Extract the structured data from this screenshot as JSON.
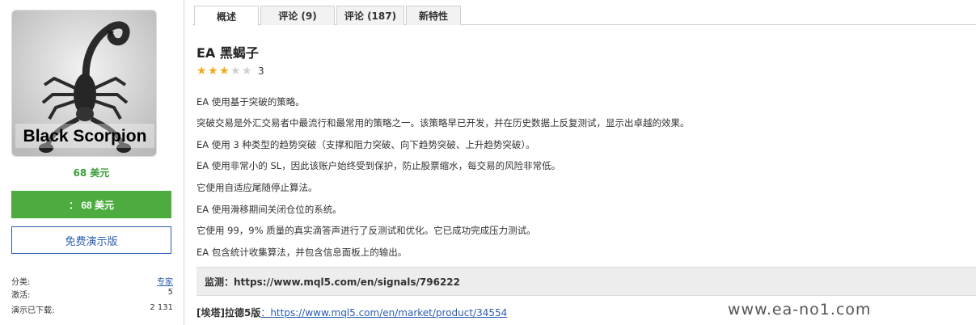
{
  "product": {
    "image_caption": "Black Scorpion",
    "price_text": "68 美元",
    "buy_label": "： 68 美元",
    "demo_label": "免费演示版"
  },
  "meta": {
    "category_label": "分类:",
    "category_value": "专家",
    "activations_label": "激活:",
    "activations_value": "5",
    "downloads_label": "演示已下载:",
    "downloads_value": "2 131"
  },
  "tabs": [
    {
      "label": "概述",
      "active": true
    },
    {
      "label": "评论 (9)",
      "active": false
    },
    {
      "label": "评论 (187)",
      "active": false
    },
    {
      "label": "新特性",
      "active": false
    }
  ],
  "main": {
    "title": "EA 黑蝎子",
    "rating": {
      "stars": 3,
      "max": 5,
      "value": "3"
    },
    "description": [
      "EA 使用基于突破的策略。",
      "突破交易是外汇交易者中最流行和最常用的策略之一。该策略早已开发，并在历史数据上反复测试，显示出卓越的效果。",
      "EA 使用 3 种类型的趋势突破（支撑和阻力突破、向下趋势突破、上升趋势突破）。",
      "EA 使用非常小的 SL，因此该账户始终受到保护，防止股票缩水，每交易的风险非常低。",
      "它使用自适应尾随停止算法。",
      "EA 使用滑移期间关闭仓位的系统。",
      "它使用 99，9% 质量的真实滴答声进行了反测试和优化。它已成功完成压力测试。",
      "EA 包含统计收集算法，并包含信息面板上的输出。"
    ],
    "monitor": "监测：https://www.mql5.com/en/signals/796222",
    "product_link_label": "[埃塔]拉德5版",
    "product_link_url": "：https://www.mql5.com/en/market/product/34554",
    "watermark": "www.ea-no1.com"
  },
  "colors": {
    "green": "#4cac3f",
    "price_green": "#3c9e3a",
    "link_blue": "#2a5db0",
    "star": "#f0a917"
  }
}
